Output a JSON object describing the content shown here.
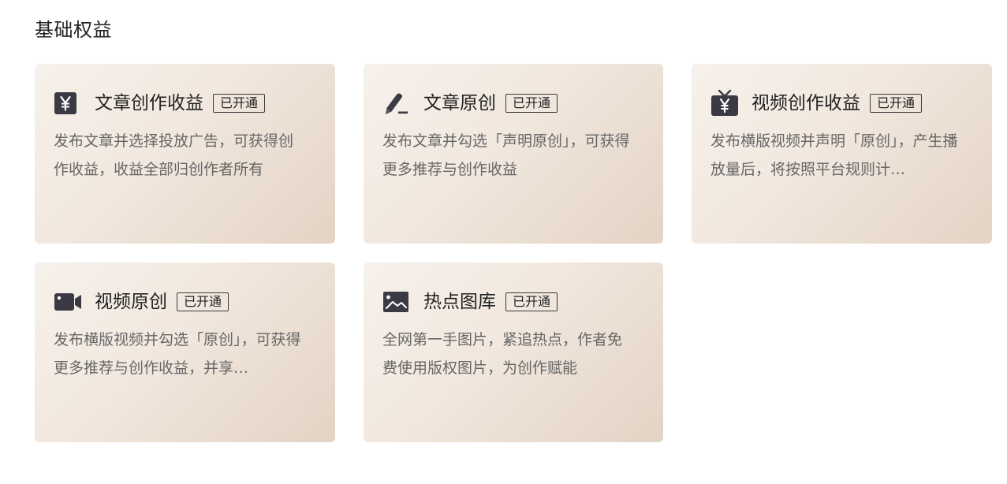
{
  "section": {
    "title": "基础权益"
  },
  "cards": [
    {
      "title": "文章创作收益",
      "status": "已开通",
      "description": "发布文章并选择投放广告，可获得创作收益，收益全部归创作者所有",
      "icon": "yuan-icon"
    },
    {
      "title": "文章原创",
      "status": "已开通",
      "description": "发布文章并勾选「声明原创」，可获得更多推荐与创作收益",
      "icon": "pen-icon"
    },
    {
      "title": "视频创作收益",
      "status": "已开通",
      "description": "发布横版视频并声明「原创」，产生播放量后，将按照平台规则计…",
      "icon": "tv-yuan-icon"
    },
    {
      "title": "视频原创",
      "status": "已开通",
      "description": "发布横版视频并勾选「原创」，可获得更多推荐与创作收益，并享…",
      "icon": "video-camera-icon"
    },
    {
      "title": "热点图库",
      "status": "已开通",
      "description": "全网第一手图片，紧追热点，作者免费使用版权图片，为创作赋能",
      "icon": "image-icon"
    }
  ],
  "colors": {
    "icon": "#3b3a44",
    "text_primary": "#222222",
    "text_secondary": "#666666",
    "card_gradient_start": "#f7f1eb",
    "card_gradient_end": "#e3d3c4"
  }
}
